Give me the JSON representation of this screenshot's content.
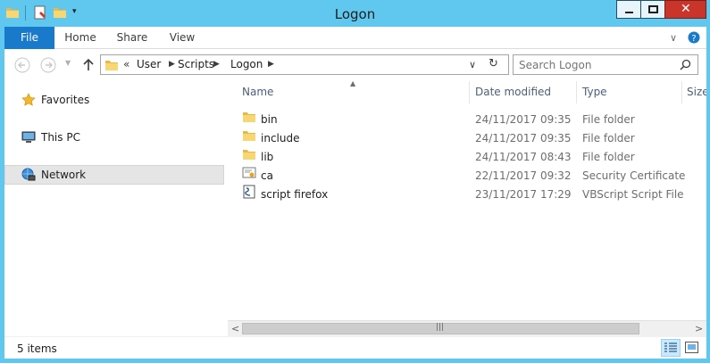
{
  "window": {
    "title": "Logon"
  },
  "ribbon": {
    "tabs": [
      {
        "label": "File"
      },
      {
        "label": "Home"
      },
      {
        "label": "Share"
      },
      {
        "label": "View"
      }
    ]
  },
  "address": {
    "overflow": "«",
    "crumbs": [
      "User",
      "Scripts",
      "Logon"
    ]
  },
  "search": {
    "placeholder": "Search Logon"
  },
  "nav": {
    "items": [
      {
        "label": "Favorites",
        "icon": "star-icon"
      },
      {
        "label": "This PC",
        "icon": "computer-icon"
      },
      {
        "label": "Network",
        "icon": "network-icon"
      }
    ]
  },
  "columns": [
    {
      "label": "Name"
    },
    {
      "label": "Date modified"
    },
    {
      "label": "Type"
    },
    {
      "label": "Size"
    }
  ],
  "files": [
    {
      "name": "bin",
      "date": "24/11/2017 09:35",
      "type": "File folder",
      "icon": "folder-icon"
    },
    {
      "name": "include",
      "date": "24/11/2017 09:35",
      "type": "File folder",
      "icon": "folder-icon"
    },
    {
      "name": "lib",
      "date": "24/11/2017 08:43",
      "type": "File folder",
      "icon": "folder-icon"
    },
    {
      "name": "ca",
      "date": "22/11/2017 09:32",
      "type": "Security Certificate",
      "icon": "certificate-icon"
    },
    {
      "name": "script firefox",
      "date": "23/11/2017 17:29",
      "type": "VBScript Script File",
      "icon": "script-icon"
    }
  ],
  "status": {
    "count": "5 items"
  },
  "colors": {
    "frame": "#60c7ee",
    "file_tab": "#1979ca",
    "close": "#c9352b"
  }
}
